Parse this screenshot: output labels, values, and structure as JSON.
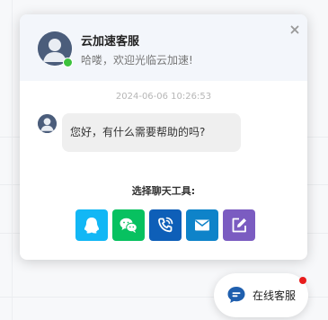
{
  "panel": {
    "agent_name": "云加速客服",
    "agent_greeting": "哈喽，欢迎光临云加速!",
    "close_symbol": "×",
    "timestamp": "2024-06-06 10:26:53",
    "message": "您好，有什么需要帮助的吗?",
    "tools_title": "选择聊天工具:",
    "tools": [
      {
        "name": "qq",
        "icon": "qq-icon",
        "color": "#12b7f5"
      },
      {
        "name": "wechat",
        "icon": "wechat-icon",
        "color": "#07c160"
      },
      {
        "name": "phone",
        "icon": "phone-icon",
        "color": "#0e5fb8"
      },
      {
        "name": "email",
        "icon": "mail-icon",
        "color": "#0e83c9"
      },
      {
        "name": "message-form",
        "icon": "edit-icon",
        "color": "#7b5cc1"
      }
    ],
    "online_status_color": "#3cc23c"
  },
  "launcher": {
    "label": "在线客服",
    "icon": "chat-bubble-icon",
    "accent": "#1f5fae",
    "notify_color": "#e81c1c"
  }
}
